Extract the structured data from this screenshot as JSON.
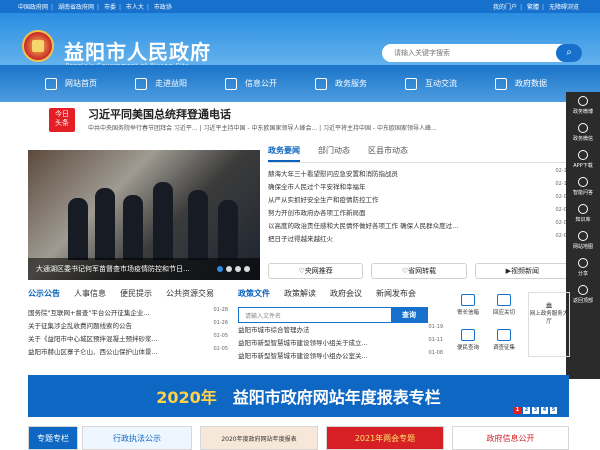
{
  "topbar": {
    "links": [
      "中国政府网",
      "湖南省政府网",
      "市委",
      "市人大",
      "市政协"
    ],
    "right": [
      "我的门户",
      "繁體",
      "无障碍浏览"
    ]
  },
  "header": {
    "title": "益阳市人民政府",
    "subtitle": "People's Government of Yiyang City",
    "search_placeholder": "请输入关键字搜索"
  },
  "nav": [
    "网站首页",
    "走进益阳",
    "信息公开",
    "政务服务",
    "互动交流",
    "政府数据"
  ],
  "today": {
    "badge_top": "今日",
    "badge_bottom": "头条",
    "headline": "习近平同美国总统拜登通电话",
    "subline": "中共中央国务院举行春节团拜会 习近平...   |  习近平主持中国 - 中东欧国家领导人峰会...   |  习近平将主持中国 - 中东欧国家领导人峰..."
  },
  "slider": {
    "caption": "大通湖区委书记何军苗督查市场疫情防控和节日...",
    "dots": [
      "1",
      "2",
      "3",
      "4"
    ]
  },
  "tabs": [
    "政务要闻",
    "部门动态",
    "区县市动态"
  ],
  "news": [
    {
      "text": "赫海大年三十看望慰问应急安置和消防指战员",
      "date": "02-11"
    },
    {
      "text": "确保全市人民过个平安祥和幸福年",
      "date": "02-10"
    },
    {
      "text": "从严从实抓好安全生产和疫情防控工作",
      "date": "02-09"
    },
    {
      "text": "努力开创市政府办各项工作新局面",
      "date": "02-09"
    },
    {
      "text": "以高度的政治责任感和大民情怀做好各项工作 确保人民群众度过...",
      "date": "02-08"
    },
    {
      "text": "把日子过得越来越红火",
      "date": "02-08"
    }
  ],
  "media": [
    "央网推荐",
    "省网转载",
    "视频新闻"
  ],
  "side": [
    "政务微博",
    "政务微信",
    "APP下载",
    "智能问答",
    "知识库",
    "网站地图",
    "分享",
    "返回顶部"
  ],
  "sections": {
    "left_tabs": [
      "公示公告",
      "人事信息",
      "便民提示",
      "公共资源交易"
    ],
    "mid_tabs": [
      "政策文件",
      "政策解读",
      "政府会议",
      "新闻发布会"
    ],
    "left_list": [
      {
        "text": "国务院\"互联网+督查\"平台公开征集企业...",
        "date": "01-28"
      },
      {
        "text": "关于征集涉企乱收费问题线索的公告",
        "date": "01-26"
      },
      {
        "text": "关于《益阳市中心城区预拌混凝土预拌砂浆...",
        "date": "02-05"
      },
      {
        "text": "益阳市赫山区寨子仑山、西公山保护山体景...",
        "date": "02-05"
      }
    ],
    "search_placeholder": "请输入文件名",
    "search_btn": "查询",
    "mid_list": [
      {
        "text": "益阳市城市综合管理办法",
        "date": "01-19"
      },
      {
        "text": "益阳市新型智慧城市建设领导小组关于成立...",
        "date": "01-11"
      },
      {
        "text": "益阳市新型智慧城市建设领导小组办公室关...",
        "date": "01-08"
      }
    ],
    "service": [
      "寄长信箱",
      "回应关切",
      "便民查询",
      "调查征集"
    ],
    "card": "网上政务服务大厅"
  },
  "banner": {
    "year": "2020年",
    "text": "益阳市政府网站年度报表专栏",
    "pages": [
      "1",
      "2",
      "3",
      "4",
      "5"
    ]
  },
  "bottom": [
    "专题专栏",
    "行政执法公示",
    "2020年度政府网站年度报表",
    "2021年两会专题",
    "政府信息公开"
  ]
}
